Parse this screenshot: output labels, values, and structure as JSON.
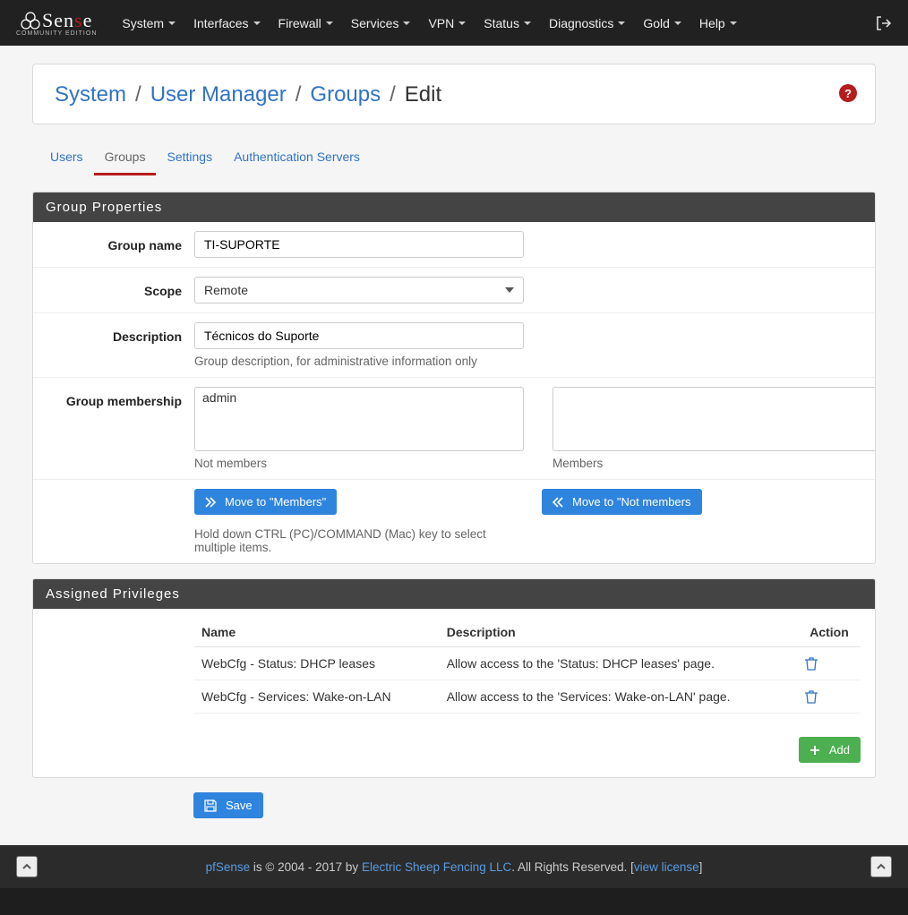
{
  "brand": {
    "maintext1": "Sen",
    "maintext_red": "s",
    "maintext_end": "e",
    "subtitle": "COMMUNITY EDITION",
    "circle_prefix": ""
  },
  "nav": {
    "items": [
      "System",
      "Interfaces",
      "Firewall",
      "Services",
      "VPN",
      "Status",
      "Diagnostics",
      "Gold",
      "Help"
    ]
  },
  "breadcrumb": {
    "seg": [
      "System",
      "User Manager",
      "Groups",
      "Edit"
    ],
    "sep": "/"
  },
  "tabs": {
    "items": [
      "Users",
      "Groups",
      "Settings",
      "Authentication Servers"
    ],
    "active_index": 1
  },
  "panel_props": {
    "title": "Group Properties",
    "labels": {
      "group_name": "Group name",
      "scope": "Scope",
      "description": "Description",
      "membership": "Group membership"
    },
    "values": {
      "group_name": "TI-SUPORTE",
      "scope": "Remote",
      "description": "Técnicos do Suporte"
    },
    "desc_help": "Group description, for administrative information only",
    "not_members_label": "Not members",
    "members_label": "Members",
    "not_members_options": [
      "admin"
    ],
    "members_options": [],
    "move_to_members": "Move to \"Members\"",
    "move_to_not_members": "Move to \"Not members",
    "hold_text": "Hold down CTRL (PC)/COMMAND (Mac) key to select multiple items."
  },
  "panel_priv": {
    "title": "Assigned Privileges",
    "columns": {
      "name": "Name",
      "description": "Description",
      "action": "Action"
    },
    "rows": [
      {
        "name": "WebCfg - Status: DHCP leases",
        "description": "Allow access to the 'Status: DHCP leases' page."
      },
      {
        "name": "WebCfg - Services: Wake-on-LAN",
        "description": "Allow access to the 'Services: Wake-on-LAN' page."
      }
    ],
    "add_label": "Add"
  },
  "save_label": "Save",
  "footer": {
    "pfsense": "pfSense",
    "mid": " is © 2004 - 2017 by ",
    "company": "Electric Sheep Fencing LLC",
    "rights": ". All Rights Reserved. [",
    "view": "view license",
    "end": "]"
  }
}
